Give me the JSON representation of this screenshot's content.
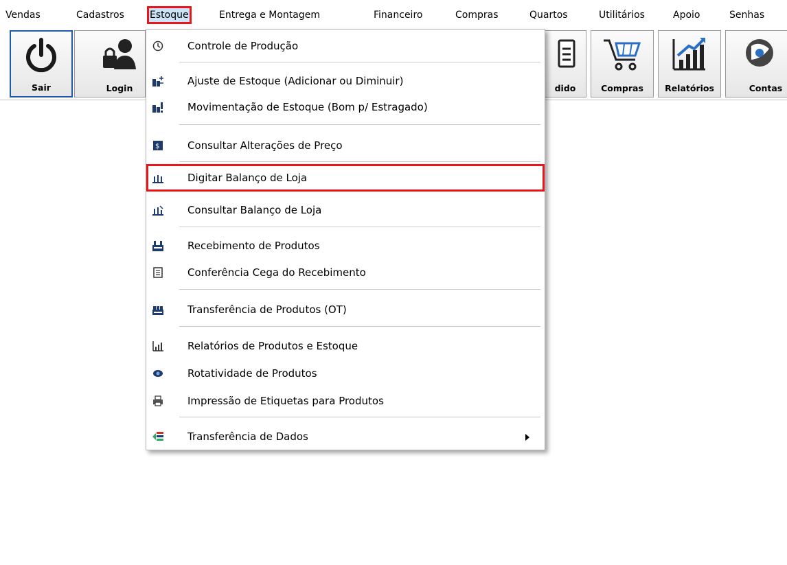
{
  "menubar": {
    "items": [
      {
        "label": "Vendas"
      },
      {
        "label": "Cadastros"
      },
      {
        "label": "Estoque"
      },
      {
        "label": "Entrega e Montagem"
      },
      {
        "label": "Financeiro"
      },
      {
        "label": "Compras"
      },
      {
        "label": "Quartos"
      },
      {
        "label": "Utilitários"
      },
      {
        "label": "Apoio"
      },
      {
        "label": "Senhas"
      }
    ]
  },
  "toolbar": {
    "buttons": [
      {
        "label": "Sair",
        "icon": "power-icon"
      },
      {
        "label": "Login",
        "icon": "user-lock-icon"
      },
      {
        "label": "dido",
        "icon": "clipboard-icon"
      },
      {
        "label": "Compras",
        "icon": "cart-icon"
      },
      {
        "label": "Relatórios",
        "icon": "chart-icon"
      },
      {
        "label": "Contas",
        "icon": "money-icon"
      }
    ]
  },
  "dropdown": {
    "items": [
      {
        "label": "Controle de Produção",
        "icon": "clock-icon"
      },
      {
        "label": "Ajuste de Estoque  (Adicionar ou Diminuir)",
        "icon": "stock-adjust-icon"
      },
      {
        "label": "Movimentação de Estoque (Bom p/ Estragado)",
        "icon": "stock-move-icon"
      },
      {
        "label": "Consultar Alterações de Preço",
        "icon": "price-icon"
      },
      {
        "label": "Digitar Balanço de Loja",
        "icon": "balance-icon"
      },
      {
        "label": "Consultar Balanço de Loja",
        "icon": "balance-query-icon"
      },
      {
        "label": "Recebimento de Produtos",
        "icon": "receive-icon"
      },
      {
        "label": "Conferência Cega do Recebimento",
        "icon": "blind-check-icon"
      },
      {
        "label": "Transferência de Produtos (OT)",
        "icon": "transfer-icon"
      },
      {
        "label": "Relatórios de Produtos e Estoque",
        "icon": "report-icon"
      },
      {
        "label": "Rotatividade de Produtos",
        "icon": "rotation-icon"
      },
      {
        "label": "Impressão de Etiquetas para Produtos",
        "icon": "printer-icon"
      },
      {
        "label": "Transferência de Dados",
        "icon": "data-transfer-icon"
      }
    ]
  },
  "colors": {
    "highlight_border": "#e8151b",
    "menu_active_bg": "#cce4f7",
    "toolbar_focus_border": "#1e5aa8"
  }
}
